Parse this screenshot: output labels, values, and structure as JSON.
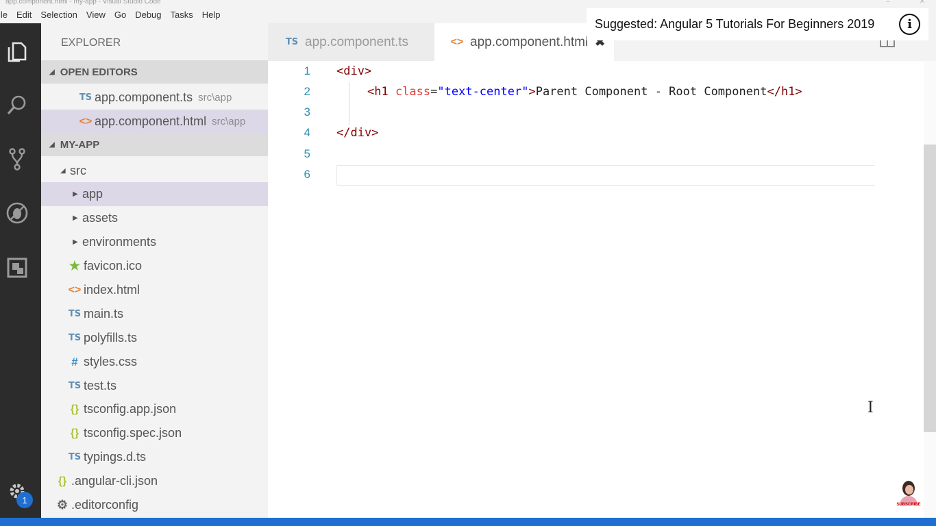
{
  "window": {
    "title": "app.component.html - my-app - Visual Studio Code"
  },
  "menu": [
    "ile",
    "Edit",
    "Selection",
    "View",
    "Go",
    "Debug",
    "Tasks",
    "Help"
  ],
  "activity_bar": {
    "icons": [
      "files-icon",
      "search-icon",
      "source-control-icon",
      "debug-icon",
      "extensions-icon",
      "settings-gear-icon"
    ],
    "badge": "1"
  },
  "sidebar": {
    "title": "EXPLORER",
    "open_editors": {
      "label": "OPEN EDITORS",
      "items": [
        {
          "icon": "TS",
          "name": "app.component.ts",
          "path": "src\\app"
        },
        {
          "icon": "<>",
          "name": "app.component.html",
          "path": "src\\app"
        }
      ]
    },
    "project": {
      "label": "MY-APP",
      "tree": [
        {
          "chevron": "▲",
          "name": "src"
        },
        {
          "chevron": "▶",
          "name": "app"
        },
        {
          "chevron": "▶",
          "name": "assets"
        },
        {
          "chevron": "▶",
          "name": "environments"
        },
        {
          "icon": "★",
          "name": "favicon.ico"
        },
        {
          "icon": "<>",
          "name": "index.html"
        },
        {
          "icon": "TS",
          "name": "main.ts"
        },
        {
          "icon": "TS",
          "name": "polyfills.ts"
        },
        {
          "icon": "#",
          "name": "styles.css"
        },
        {
          "icon": "TS",
          "name": "test.ts"
        },
        {
          "icon": "{}",
          "name": "tsconfig.app.json"
        },
        {
          "icon": "{}",
          "name": "tsconfig.spec.json"
        },
        {
          "icon": "TS",
          "name": "typings.d.ts"
        },
        {
          "icon": "{}",
          "name": ".angular-cli.json"
        },
        {
          "icon": "⚙",
          "name": ".editorconfig"
        }
      ]
    }
  },
  "tabs": [
    {
      "icon": "TS",
      "label": "app.component.ts",
      "active": false
    },
    {
      "icon": "<>",
      "label": "app.component.html",
      "active": true,
      "close": "✖"
    }
  ],
  "editor": {
    "lines": [
      {
        "n": "1",
        "parts": {
          "t1": "<div>"
        }
      },
      {
        "n": "2",
        "parts": {
          "t1": "<h1 ",
          "a": "class",
          "eq": "=",
          "s": "\"text-center\"",
          "t2": ">",
          "x": "Parent Component - Root Component",
          "t3": "</h1>"
        }
      },
      {
        "n": "3",
        "parts": {}
      },
      {
        "n": "4",
        "parts": {
          "t1": "</div>"
        }
      },
      {
        "n": "5",
        "parts": {}
      },
      {
        "n": "6",
        "parts": {}
      }
    ]
  },
  "suggestion": {
    "text": "Suggested: Angular 5 Tutorials For Beginners 2019",
    "icon": "i"
  },
  "avatar": {
    "label": "SUBSCRIBE"
  },
  "colors": {
    "activity_bar": "#2c2c2c",
    "sidebar": "#f3f3f3",
    "selection": "#ddd8e8",
    "status_bar": "#1e6fd0",
    "tag": "#800000",
    "attribute": "#e04040",
    "string": "#0000ff"
  }
}
